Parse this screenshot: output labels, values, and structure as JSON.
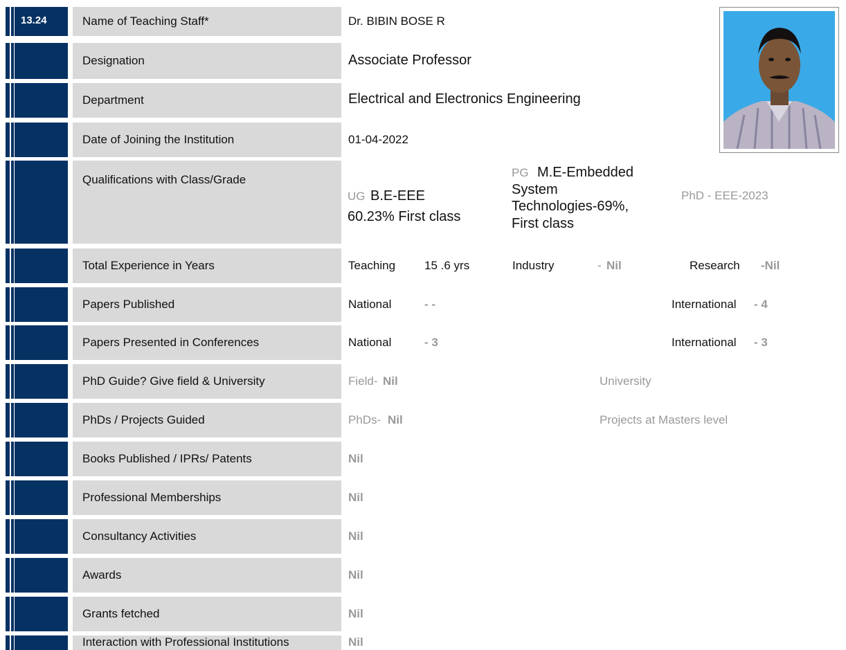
{
  "header": {
    "section_number": "13.24"
  },
  "rows": {
    "name": {
      "label": "Name of Teaching Staff*",
      "value": "Dr. BIBIN BOSE R"
    },
    "designation": {
      "label": "Designation",
      "value": "Associate Professor"
    },
    "department": {
      "label": "Department",
      "value": "Electrical and Electronics Engineering"
    },
    "joining": {
      "label": "Date of Joining the Institution",
      "value": "01-04-2022"
    },
    "qualifications": {
      "label": "Qualifications with Class/Grade",
      "ug_prefix": "UG",
      "ug_degree": "B.E-EEE",
      "ug_grade": "60.23% First class",
      "pg_prefix": "PG",
      "pg_line1": "M.E-Embedded",
      "pg_line2": "System",
      "pg_line3": "Technologies-69%,",
      "pg_line4": "First class",
      "phd": "PhD  - EEE-2023"
    },
    "experience": {
      "label": "Total Experience in Years",
      "teaching_label": "Teaching",
      "teaching_value": "15 .6 yrs",
      "industry_label": "Industry",
      "industry_dash": "- ",
      "industry_value": "Nil",
      "research_label": "Research",
      "research_value": "-Nil"
    },
    "papers_published": {
      "label": "Papers Published",
      "national_label": "National",
      "national_value": "- -",
      "international_label": "International",
      "international_value": "- 4"
    },
    "papers_presented": {
      "label": "Papers Presented in Conferences",
      "national_label": "National",
      "national_value": "- 3",
      "international_label": "International",
      "international_value": "- 3"
    },
    "phd_guide": {
      "label": "PhD Guide? Give field & University",
      "field_label": "Field- ",
      "field_value": "Nil",
      "university_label": "University"
    },
    "guided": {
      "label": "PhDs / Projects Guided",
      "phds_label": "PhDs- ",
      "phds_value": "Nil",
      "projects_label": "Projects at Masters level"
    },
    "books": {
      "label": "Books Published / IPRs/ Patents",
      "value": "Nil"
    },
    "memberships": {
      "label": "Professional Memberships",
      "value": "Nil"
    },
    "consultancy": {
      "label": "Consultancy Activities",
      "value": "Nil"
    },
    "awards": {
      "label": "Awards",
      "value": "Nil"
    },
    "grants": {
      "label": "Grants fetched",
      "value": "Nil"
    },
    "interaction": {
      "label": "Interaction with Professional Institutions",
      "value": "Nil"
    }
  },
  "colors": {
    "nav_bar": "#063163",
    "label_bg": "#d9d9d9",
    "muted_text": "#999999"
  }
}
